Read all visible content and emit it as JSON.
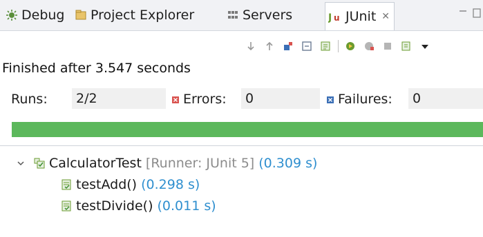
{
  "tabs": [
    {
      "label": "Debug",
      "icon": "debug-icon"
    },
    {
      "label": "Project Explorer",
      "icon": "project-explorer-icon"
    },
    {
      "label": "Servers",
      "icon": "servers-icon"
    },
    {
      "label": "JUnit",
      "icon": "junit-icon",
      "active": true,
      "close_glyph": "✕"
    }
  ],
  "toolbar": {
    "icons": [
      "next-failure-icon",
      "previous-failure-icon",
      "show-failures-only-icon",
      "scroll-lock-icon",
      "show-skipped-icon",
      "rerun-icon",
      "rerun-failed-first-icon",
      "stop-icon",
      "test-run-history-icon",
      "view-menu-icon"
    ]
  },
  "status": {
    "text": "Finished after 3.547 seconds"
  },
  "counters": {
    "runs_label": "Runs:",
    "runs_value": "2/2",
    "errors_label": "Errors:",
    "errors_value": "0",
    "failures_label": "Failures:",
    "failures_value": "0"
  },
  "progress": {
    "fraction": 1.0,
    "color": "#5cb85c"
  },
  "tree": {
    "suite": {
      "name": "CalculatorTest",
      "runner": "[Runner: JUnit 5]",
      "time": "(0.309 s)"
    },
    "tests": [
      {
        "name": "testAdd()",
        "time": "(0.298 s)"
      },
      {
        "name": "testDivide()",
        "time": "(0.011 s)"
      }
    ]
  },
  "colors": {
    "accent": "#2f8fcf",
    "pass": "#5cb85c",
    "error": "#d9534f",
    "failure": "#3b6fb6"
  }
}
